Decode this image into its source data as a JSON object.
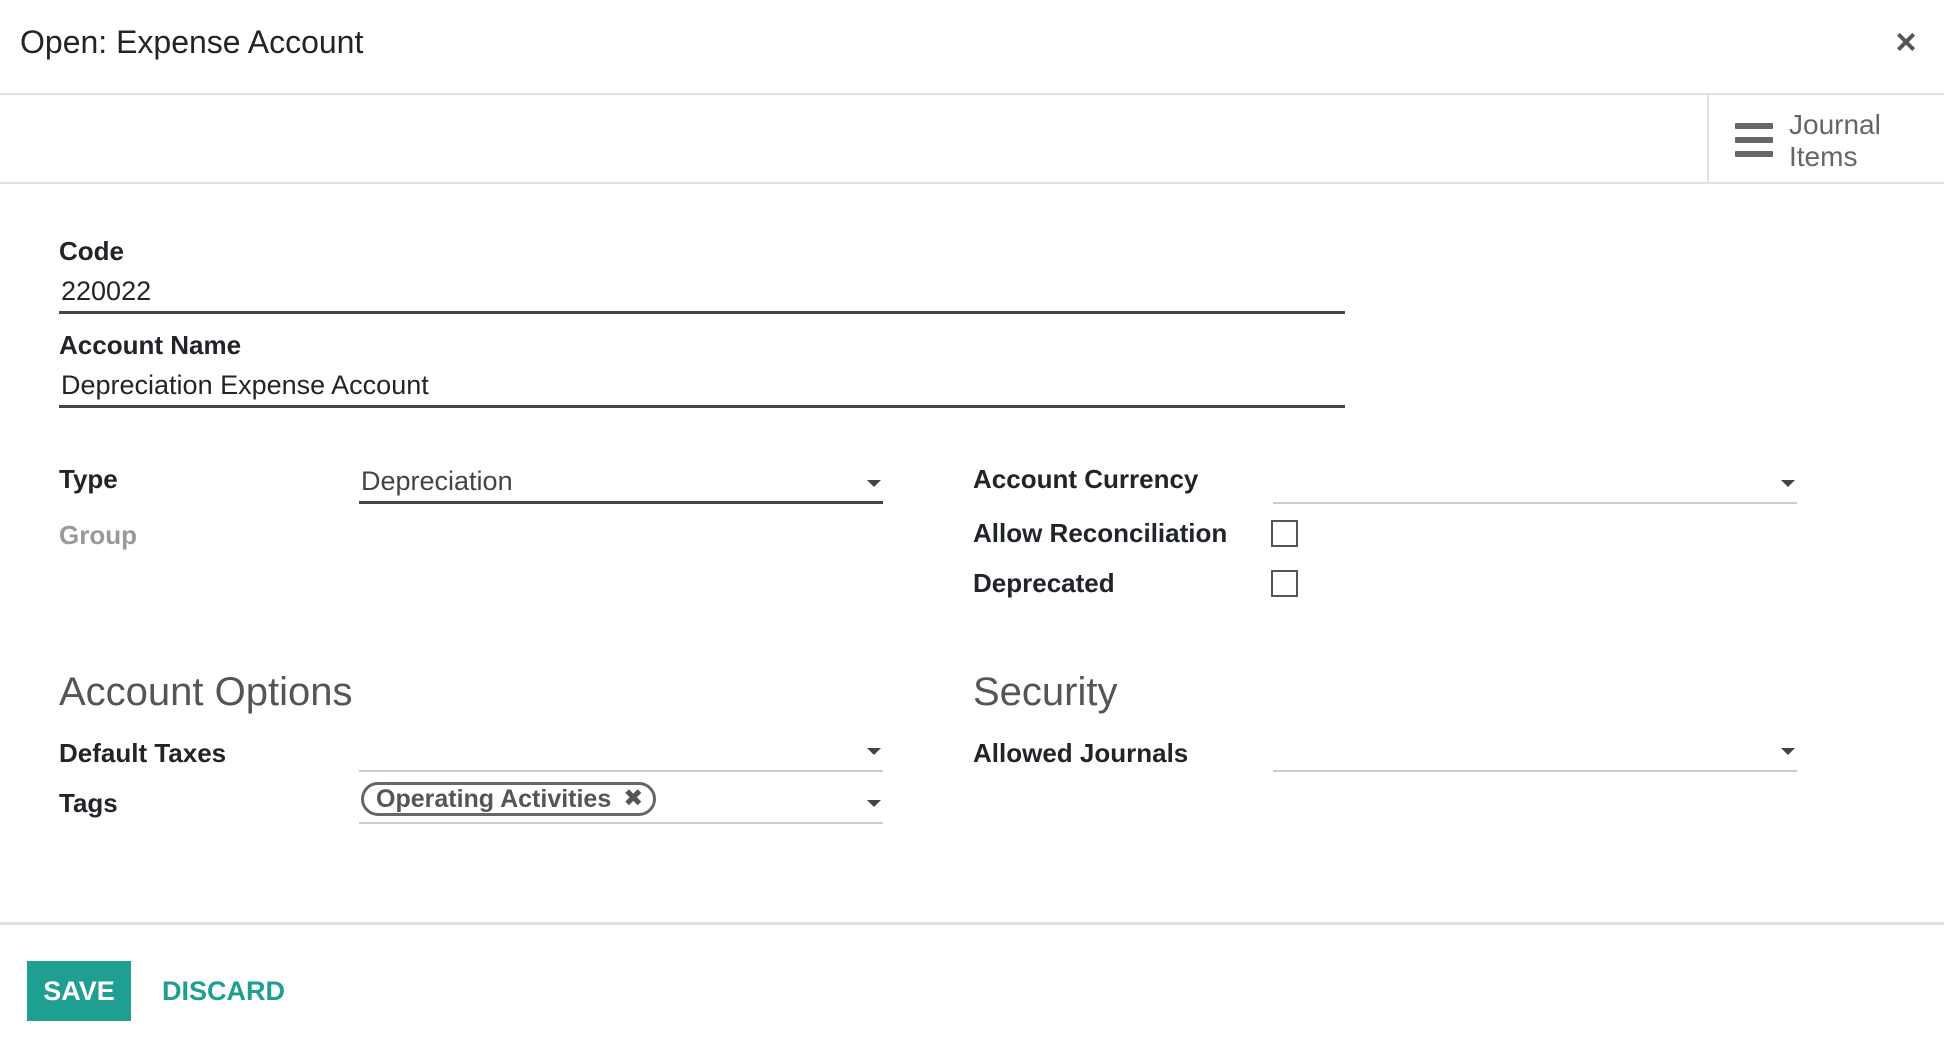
{
  "dialog": {
    "title": "Open: Expense Account",
    "close_label": "×"
  },
  "smart_button": {
    "icon": "list-icon",
    "line1": "Journal",
    "line2": "Items"
  },
  "form": {
    "code_label": "Code",
    "code_value": "220022",
    "name_label": "Account Name",
    "name_value": "Depreciation Expense Account",
    "type_label": "Type",
    "type_value": "Depreciation",
    "group_label": "Group",
    "currency_label": "Account Currency",
    "currency_value": "",
    "reconcile_label": "Allow Reconciliation",
    "reconcile_checked": false,
    "deprecated_label": "Deprecated",
    "deprecated_checked": false
  },
  "account_options": {
    "title": "Account Options",
    "default_taxes_label": "Default Taxes",
    "default_taxes_value": "",
    "tags_label": "Tags",
    "tags": [
      "Operating Activities"
    ],
    "tag_remove_glyph": "✖"
  },
  "security": {
    "title": "Security",
    "allowed_journals_label": "Allowed Journals",
    "allowed_journals_value": ""
  },
  "footer": {
    "save_label": "SAVE",
    "discard_label": "DISCARD"
  },
  "colors": {
    "primary": "#1f9e92",
    "border": "#dee2e6"
  }
}
